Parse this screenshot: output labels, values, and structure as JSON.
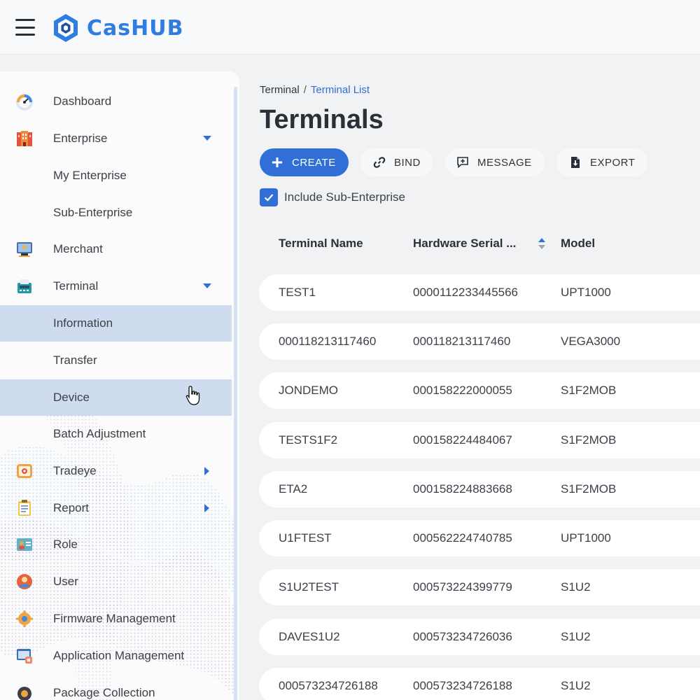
{
  "app": {
    "brand": "CasHUB",
    "brand_color": "#2f7de1",
    "accent_color": "#2f6fd6"
  },
  "sidebar": {
    "items": [
      {
        "label": "Dashboard",
        "icon": "dashboard-gauge-icon",
        "caret": ""
      },
      {
        "label": "Enterprise",
        "icon": "enterprise-building-icon",
        "caret": "down"
      },
      {
        "label": "My Enterprise",
        "icon": "",
        "caret": ""
      },
      {
        "label": "Sub-Enterprise",
        "icon": "",
        "caret": ""
      },
      {
        "label": "Merchant",
        "icon": "merchant-icon",
        "caret": ""
      },
      {
        "label": "Terminal",
        "icon": "terminal-icon",
        "caret": "down"
      },
      {
        "label": "Information",
        "icon": "",
        "caret": "",
        "active": true
      },
      {
        "label": "Transfer",
        "icon": "",
        "caret": ""
      },
      {
        "label": "Device",
        "icon": "",
        "caret": "",
        "hover": true
      },
      {
        "label": "Batch Adjustment",
        "icon": "",
        "caret": ""
      },
      {
        "label": "Tradeye",
        "icon": "tradeye-icon",
        "caret": "right"
      },
      {
        "label": "Report",
        "icon": "report-clipboard-icon",
        "caret": "right"
      },
      {
        "label": "Role",
        "icon": "role-icon",
        "caret": ""
      },
      {
        "label": "User",
        "icon": "user-icon",
        "caret": ""
      },
      {
        "label": "Firmware Management",
        "icon": "firmware-icon",
        "caret": ""
      },
      {
        "label": "Application Management",
        "icon": "application-icon",
        "caret": ""
      },
      {
        "label": "Package Collection",
        "icon": "package-icon",
        "caret": ""
      }
    ]
  },
  "breadcrumb": {
    "parent": "Terminal",
    "separator": "/",
    "current": "Terminal List"
  },
  "page": {
    "title": "Terminals"
  },
  "toolbar": {
    "create_label": "CREATE",
    "bind_label": "BIND",
    "message_label": "MESSAGE",
    "export_label": "EXPORT"
  },
  "filter": {
    "include_sub_label": "Include Sub-Enterprise",
    "include_sub_checked": true
  },
  "table": {
    "columns": [
      "Terminal Name",
      "Hardware Serial ...",
      "Model"
    ],
    "rows": [
      {
        "name": "TEST1",
        "serial": "0000112233445566",
        "model": "UPT1000"
      },
      {
        "name": "000118213117460",
        "serial": "000118213117460",
        "model": "VEGA3000"
      },
      {
        "name": "JONDEMO",
        "serial": "000158222000055",
        "model": "S1F2MOB"
      },
      {
        "name": "TESTS1F2",
        "serial": "000158224484067",
        "model": "S1F2MOB"
      },
      {
        "name": "ETA2",
        "serial": "000158224883668",
        "model": "S1F2MOB"
      },
      {
        "name": "U1FTEST",
        "serial": "000562224740785",
        "model": "UPT1000"
      },
      {
        "name": "S1U2TEST",
        "serial": "000573224399779",
        "model": "S1U2"
      },
      {
        "name": "DAVES1U2",
        "serial": "000573234726036",
        "model": "S1U2"
      },
      {
        "name": "000573234726188",
        "serial": "000573234726188",
        "model": "S1U2"
      }
    ]
  }
}
